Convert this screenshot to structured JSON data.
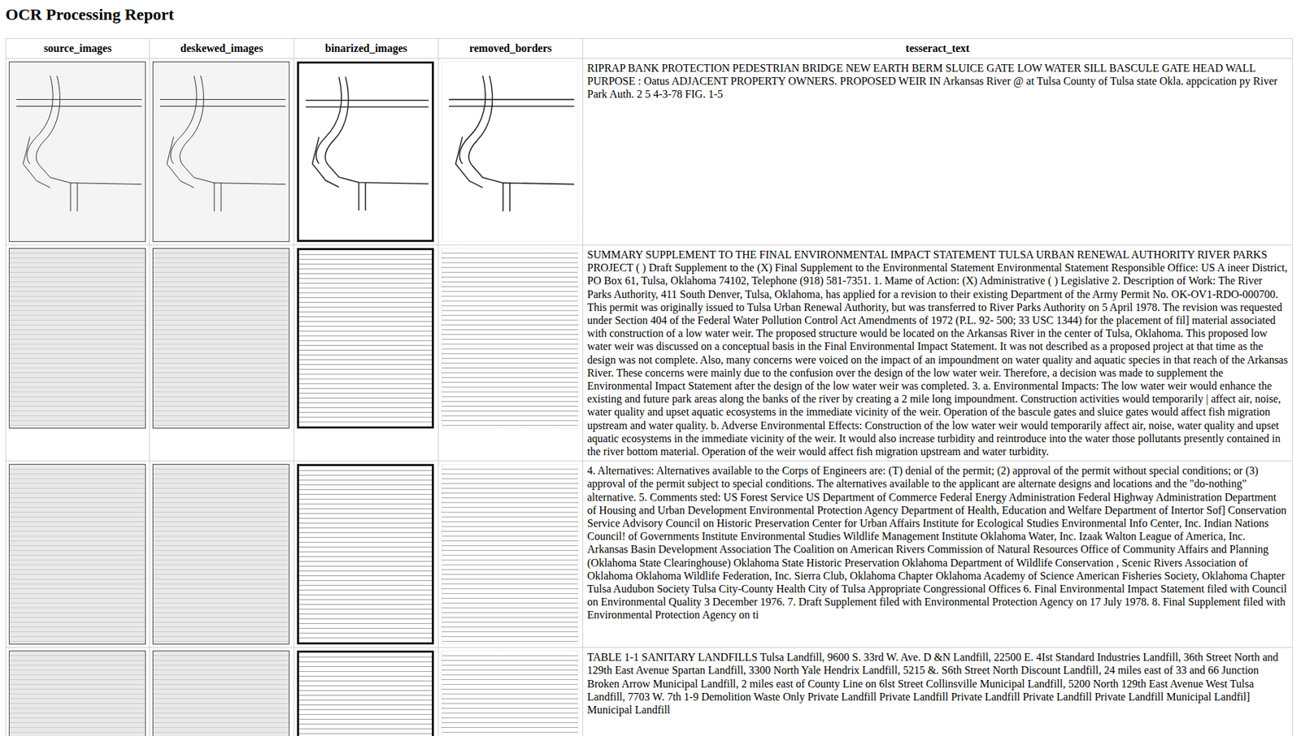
{
  "title": "OCR Processing Report",
  "columns": [
    "source_images",
    "deskewed_images",
    "binarized_images",
    "removed_borders",
    "tesseract_text"
  ],
  "rows": [
    {
      "kind": "drawing",
      "text": "RIPRAP BANK PROTECTION PEDESTRIAN BRIDGE NEW EARTH BERM SLUICE GATE LOW WATER SILL BASCULE GATE HEAD WALL PURPOSE : Oatus ADJACENT PROPERTY OWNERS. PROPOSED WEIR IN Arkansas River @ at Tulsa County of Tulsa state Okla. appcication py River Park Auth. 2 5 4-3-78 FIG. 1-5"
    },
    {
      "kind": "page",
      "text": "SUMMARY SUPPLEMENT TO THE FINAL ENVIRONMENTAL IMPACT STATEMENT TULSA URBAN RENEWAL AUTHORITY RIVER PARKS PROJECT ( ) Draft Supplement to the (X) Final Supplement to the Environmental Statement Environmental Statement Responsible Office: US A ineer District, PO Box 61, Tulsa, Oklahoma 74102, Telephone (918) 581-7351. 1. Mame of Action: (X) Administrative ( ) Legislative 2. Description of Work: The River Parks Authority, 411 South Denver, Tulsa, Oklahoma, has applied for a revision to their existing Department of the Army Permit No. OK-OV1-RDO-000700. This permit was originally issued to Tulsa Urban Renewal Authority, but was transferred to River Parks Authority on 5 April 1978. The revision was requested under Section 404 of the Federal Water Pollution Control Act Amendments of 1972 (P.L. 92- 500; 33 USC 1344) for the placement of fil] material associated with construction of a low water weir. The proposed structure would be located on the Arkansas River in the center of Tulsa, Oklahoma. This proposed low water weir was discussed on a conceptual basis in the Final Environmental Impact Statement. It was not described as a proposed project at that time as the design was not complete. Also, many concerns were voiced on the impact of an impoundment on water quality and aquatic species in that reach of the Arkansas River. These concerns were mainly due to the confusion over the design of the low water weir. Therefore, a decision was made to supplement the Environmental Impact Statement after the design of the low water weir was completed. 3. a. Environmental Impacts: The low water weir would enhance the existing and future park areas along the banks of the river by creating a 2 mile long impoundment. Construction activities would temporarily | affect air, noise, water quality and upset aquatic ecosystems in the immediate vicinity of the weir. Operation of the bascule gates and sluice gates would affect fish migration upstream and water quality. b. Adverse Environmental Effects: Construction of the low water weir would temporarily affect air, noise, water quality and upset aquatic ecosystems in the immediate vicinity of the weir. It would also increase turbidity and reintroduce into the water those pollutants presently contained in the river bottom material. Operation of the weir would affect fish migration upstream and water turbidity."
    },
    {
      "kind": "page",
      "text": "4. Alternatives: Alternatives available to the Corps of Engineers are: (T) denial of the permit; (2) approval of the permit without special conditions; or (3) approval of the permit subject to special conditions. The alternatives available to the applicant are alternate designs and locations and the \"do-nothing\" alternative. 5. Comments sted: US Forest Service US Department of Commerce Federal Energy Administration Federal Highway Administration Department of Housing and Urban Development Environmental Protection Agency Department of Health, Education and Welfare Department of Intertor Sof] Conservation Service Advisory Council on Historic Preservation Center for Urban Affairs Institute for Ecological Studies Environmental Info Center, Inc. Indian Nations Council! of Governments Institute Environmental Studies Wildlife Management Institute Oklahoma Water, Inc. Izaak Walton League of America, Inc. Arkansas Basin Development Association The Coalition on American Rivers Commission of Natural Resources Office of Community Affairs and Planning (Oklahoma State Clearinghouse) Oklahoma State Historic Preservation Oklahoma Department of Wildlife Conservation , Scenic Rivers Association of Oklahoma Oklahoma Wildlife Federation, Inc. Sierra Club, Oklahoma Chapter Oklahoma Academy of Science American Fisheries Society, Oklahoma Chapter Tulsa Audubon Society Tulsa City-County Health City of Tulsa Appropriate Congressional Offices 6. Final Environmental Impact Statement filed with Council on Environmental Quality 3 December 1976. 7. Draft Supplement filed with Environmental Protection Agency on 17 July 1978. 8. Final Supplement filed with Environmental Protection Agency on ti"
    },
    {
      "kind": "page",
      "text": "TABLE 1-1 SANITARY LANDFILLS Tulsa Landfill, 9600 S. 33rd W. Ave. D &N Landfill, 22500 E. 4Ist Standard Industries Landfill, 36th Street North and 129th East Avenue Spartan Landfill, 3300 North Yale Hendrix Landfill, 5215 &. S6th Street North Discount Landfill, 24 miles east of 33 and 66 Junction Broken Arrow Municipal Landfill, 2 miles east of County Line on 6lst Street Collinsville Municipal Landfill, 5200 North 129th East Avenue West Tulsa Landfill, 7703 W. 7th 1-9 Demolition Waste Only Private Landfill Private Landfill Private Landfill Private Landfill Private Landfill Municipal Landfil] Municipal Landfill"
    }
  ]
}
